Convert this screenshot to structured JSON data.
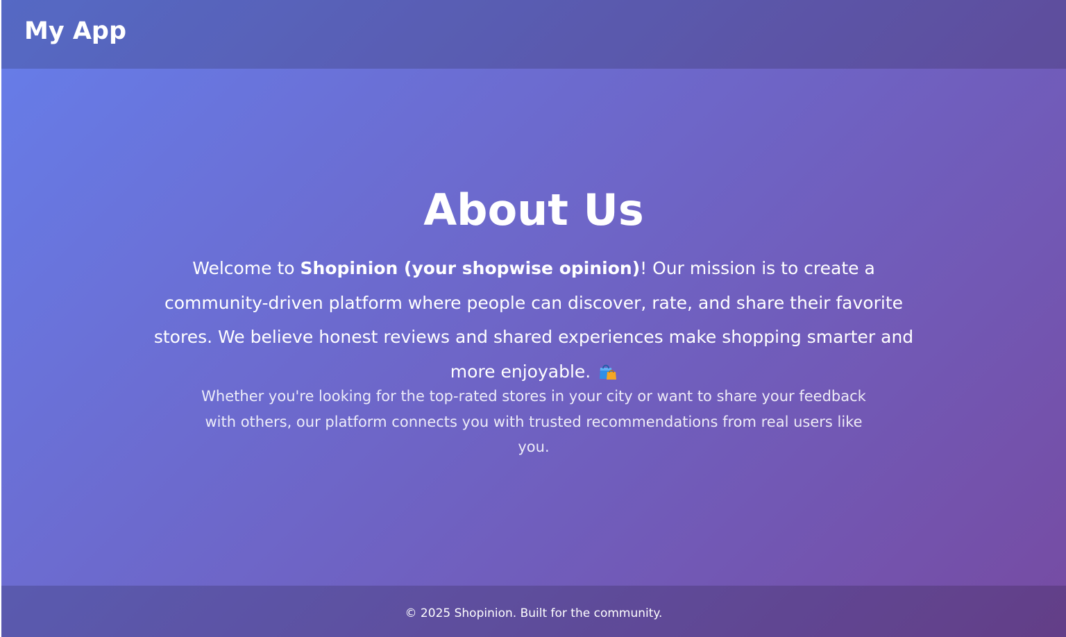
{
  "navbar": {
    "brand": "My App"
  },
  "about": {
    "title": "About Us",
    "intro_prefix": "Welcome to ",
    "intro_brand": "Shopinion (your shopwise opinion)",
    "intro_suffix": "! Our mission is to create a community-driven platform where people can discover, rate, and share their favorite stores. We believe honest reviews and shared experiences make shopping smarter and more enjoyable. ",
    "intro_icon": "shopping-bags-icon",
    "detail": "Whether you're looking for the top-rated stores in your city or want to share your feedback with others, our platform connects you with trusted recommendations from real users like you."
  },
  "footer": {
    "text": "© 2025 Shopinion. Built for the community."
  },
  "colors": {
    "gradient_start": "#667eea",
    "gradient_end": "#764ba2",
    "text": "#ffffff"
  }
}
